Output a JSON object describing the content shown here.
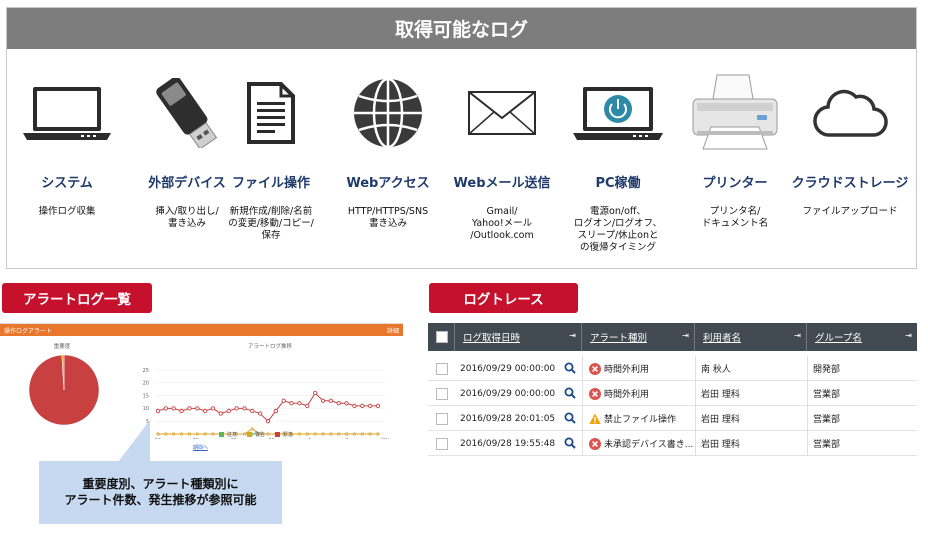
{
  "header": {
    "title": "取得可能なログ"
  },
  "log_types": [
    {
      "icon": "laptop-icon",
      "title": "システム",
      "desc": "操作ログ収集"
    },
    {
      "icon": "usb-drive-icon",
      "title": "外部デバイス",
      "desc": "挿入/取り出し/\n書き込み"
    },
    {
      "icon": "document-icon",
      "title": "ファイル操作",
      "desc": "新規作成/削除/名前\nの変更/移動/コピー/\n保存"
    },
    {
      "icon": "globe-icon",
      "title": "Webアクセス",
      "desc": "HTTP/HTTPS/SNS\n書き込み"
    },
    {
      "icon": "envelope-icon",
      "title": "Webメール送信",
      "desc": "Gmail/\nYahoo!メール\n/Outlook.com"
    },
    {
      "icon": "laptop-power-icon",
      "title": "PC稼働",
      "desc": "電源on/off、\nログオン/ログオフ、\nスリープ/休止onと\nの復帰タイミング"
    },
    {
      "icon": "printer-icon",
      "title": "プリンター",
      "desc": "プリンタ名/\nドキュメント名"
    },
    {
      "icon": "cloud-icon",
      "title": "クラウドストレージ",
      "desc": "ファイルアップロード"
    }
  ],
  "alert_section": {
    "label": "アラートログ一覧",
    "panel_title": "操作ログアラート",
    "panel_link": "詳細",
    "pie_title": "重要度",
    "pie_legend": [
      "緊急",
      "警告"
    ],
    "line_title": "アラートログ推移",
    "line_legend": [
      "注意",
      "警告",
      "緊急"
    ],
    "period_link": "期間へ",
    "callout_lines": [
      "重要度別、アラート種類別に",
      "アラート件数、発生推移が参照可能"
    ]
  },
  "colors": {
    "accent_red": "#c5112b",
    "header_gray": "#7d7d7d",
    "title_navy": "#1f3a6b",
    "table_header": "#424a51",
    "orange_bar": "#e8772b",
    "pie_red": "#c84040",
    "callout_blue": "#c6d9f0"
  },
  "chart_data": {
    "type": "line",
    "title": "アラートログ推移",
    "x_ticks": [
      "15",
      "20",
      "25",
      "30",
      "4",
      "9",
      "(日)"
    ],
    "ylim": [
      0,
      25
    ],
    "y_ticks": [
      0,
      5,
      10,
      15,
      20,
      25
    ],
    "series": [
      {
        "name": "緊急",
        "color": "#c84040",
        "values": [
          9,
          10,
          10,
          9,
          10,
          10,
          9,
          10,
          8,
          9,
          10,
          10,
          9,
          8,
          5,
          9,
          13,
          12,
          12,
          11,
          16,
          13,
          13,
          12,
          12,
          11,
          11,
          11,
          11
        ]
      },
      {
        "name": "警告",
        "color": "#e0a020",
        "values": [
          0,
          0,
          0,
          0,
          0,
          0,
          0,
          0,
          0,
          0,
          0,
          0,
          2,
          0,
          0,
          0,
          0,
          0,
          0,
          0,
          0,
          0,
          0,
          0,
          0,
          0,
          0,
          0,
          0
        ]
      },
      {
        "name": "注意",
        "color": "#5cb85c",
        "values": [
          0,
          0,
          0,
          0,
          0,
          0,
          0,
          0,
          0,
          0,
          0,
          0,
          0,
          0,
          0,
          0,
          0,
          0,
          0,
          0,
          0,
          0,
          0,
          0,
          0,
          0,
          0,
          0,
          0
        ]
      }
    ],
    "pie": {
      "title": "重要度",
      "slices": [
        {
          "name": "緊急",
          "value": 99,
          "color": "#c84040"
        },
        {
          "name": "警告",
          "value": 1,
          "color": "#e0a020"
        }
      ]
    }
  },
  "trace_section": {
    "label": "ログトレース",
    "columns": [
      "ログ取得日時",
      "アラート種別",
      "利用者名",
      "グループ名"
    ],
    "rows": [
      {
        "datetime": "2016/09/29 00:00:00",
        "status": "error",
        "alert": "時間外利用",
        "user": "南 秋人",
        "group": "開発部"
      },
      {
        "datetime": "2016/09/29 00:00:00",
        "status": "error",
        "alert": "時間外利用",
        "user": "岩田 理科",
        "group": "営業部"
      },
      {
        "datetime": "2016/09/28 20:01:05",
        "status": "warning",
        "alert": "禁止ファイル操作",
        "user": "岩田 理科",
        "group": "営業部"
      },
      {
        "datetime": "2016/09/28 19:55:48",
        "status": "error",
        "alert": "未承認デバイス書き...",
        "user": "岩田 理科",
        "group": "営業部"
      }
    ]
  }
}
